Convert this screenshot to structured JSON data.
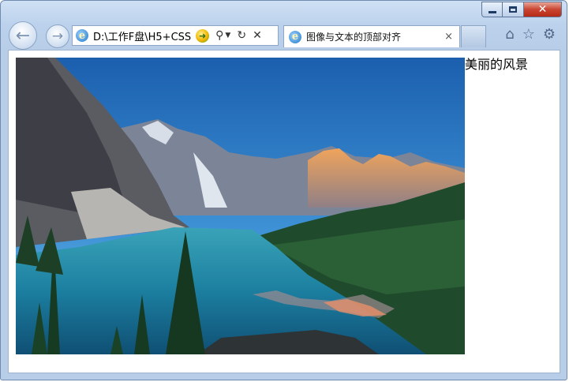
{
  "browser": {
    "address": "D:\\工作F盘\\H5+CSS",
    "tab_title": "图像与文本的顶部对齐",
    "tab_close": "×",
    "ie_glyph": "e",
    "go_glyph": "➜",
    "search_glyph": "⚲",
    "dropdown_glyph": "▼",
    "refresh_glyph": "↻",
    "stop_glyph": "✕",
    "back_glyph": "←",
    "forward_glyph": "→",
    "home_glyph": "⌂",
    "favorites_glyph": "☆",
    "tools_glyph": "⚙",
    "close_glyph": "✕"
  },
  "page": {
    "caption": "美丽的风景",
    "image_alt": "mountain lake landscape"
  },
  "colors": {
    "frame": "#bcd2ec",
    "accent_blue": "#1c76c9",
    "close_red": "#c94531"
  }
}
